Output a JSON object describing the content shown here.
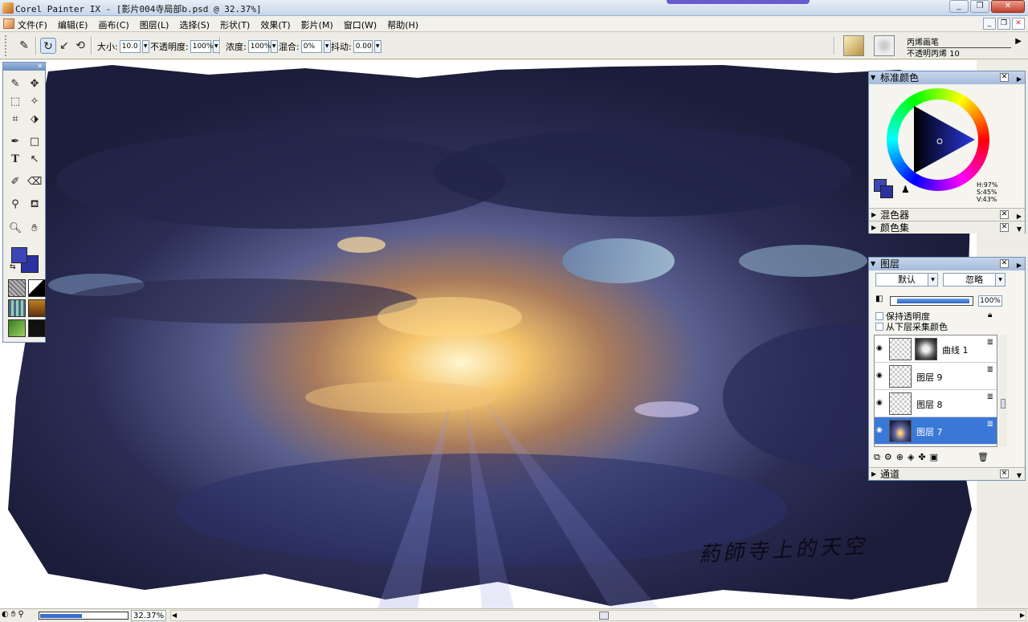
{
  "window": {
    "title": "Corel Painter IX - [影片004寺局部b.psd @ 32.37%]",
    "minimize_icon": "minimize-icon",
    "restore_icon": "restore-icon",
    "close_icon": "close-icon"
  },
  "menu": {
    "items": [
      "文件(F)",
      "编辑(E)",
      "画布(C)",
      "图层(L)",
      "选择(S)",
      "形状(T)",
      "效果(T)",
      "影片(M)",
      "窗口(W)",
      "帮助(H)"
    ]
  },
  "propbar": {
    "size_label": "大小:",
    "size_value": "10.0",
    "opacity_label": "不透明度:",
    "opacity_value": "100%",
    "grain_label": "浓度:",
    "grain_value": "100%",
    "resat_label": "混合:",
    "resat_value": "0%",
    "jitter_label": "抖动:",
    "jitter_value": "0.00",
    "brush_category": "丙烯画笔",
    "brush_variant": "不透明丙烯 10"
  },
  "colors_panel": {
    "title": "标准颜色",
    "h": "H:97%",
    "s": "S:45%",
    "v": "V:43%",
    "mixer": "混色器",
    "color_sets": "颜色集",
    "main_color": "#3d46b8",
    "secondary_color": "#2b32a0"
  },
  "layers_panel": {
    "title": "图层",
    "composite_method": "默认",
    "composite_depth": "忽略",
    "opacity_value": "100%",
    "opacity_fraction": 1.0,
    "preserve_transparency": "保持透明度",
    "pick_up_underlying": "从下层采集颜色",
    "layers": [
      {
        "name": "曲线 1",
        "selected": false
      },
      {
        "name": "图层 9",
        "selected": false
      },
      {
        "name": "图层 8",
        "selected": false
      },
      {
        "name": "图层 7",
        "selected": true
      }
    ],
    "channels": "通道"
  },
  "status": {
    "zoom": "32.37%",
    "zoom_fraction": 0.3237
  },
  "canvas": {
    "signature": "葯師寺上的天空"
  }
}
